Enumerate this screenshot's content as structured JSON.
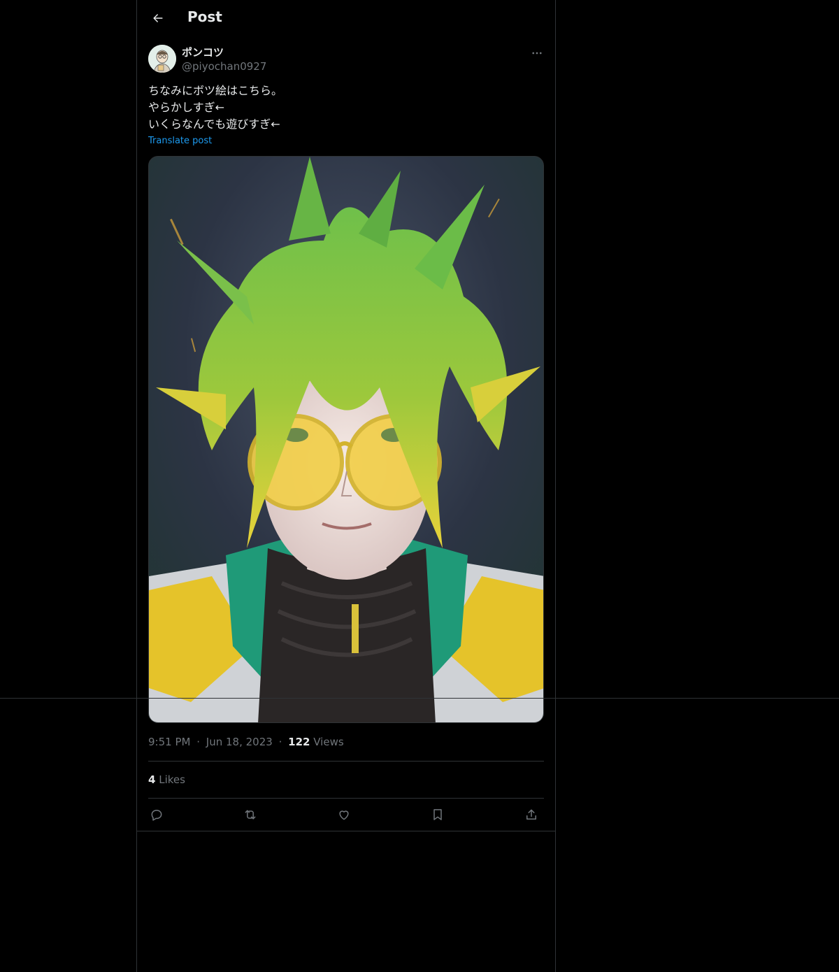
{
  "header": {
    "title": "Post",
    "back_icon": "arrow-left-icon"
  },
  "author": {
    "display_name": "ポンコツ",
    "handle": "@piyochan0927"
  },
  "tweet": {
    "lines": [
      "ちなみにボツ絵はこちら。",
      "やらかしすぎ←",
      "いくらなんでも遊びすぎ←"
    ],
    "translate_label": "Translate post"
  },
  "meta": {
    "time": "9:51 PM",
    "dot": "·",
    "date": "Jun 18, 2023",
    "views_count": "122",
    "views_label": "Views"
  },
  "likes": {
    "count": "4",
    "label": "Likes"
  },
  "actions": [
    "reply-icon",
    "retweet-icon",
    "like-icon",
    "bookmark-icon",
    "share-icon"
  ],
  "colors": {
    "background": "#000000",
    "text": "#e7e9ea",
    "muted": "#71767b",
    "link": "#1d9bf0",
    "border": "#2f3336"
  }
}
